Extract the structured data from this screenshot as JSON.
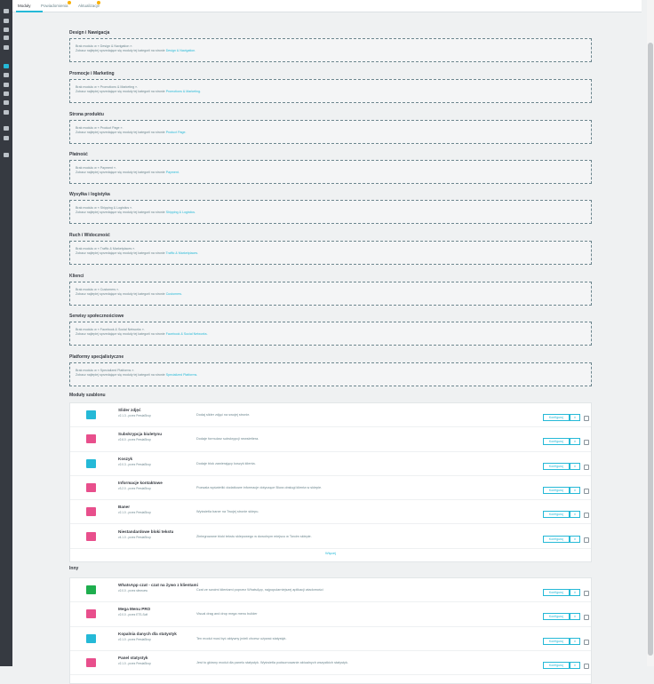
{
  "tabs": [
    {
      "label": "Moduły"
    },
    {
      "label": "Powiadomienia"
    },
    {
      "label": "Aktualizacje"
    }
  ],
  "categories": [
    {
      "title": "Design i Nawigacja",
      "line1": "Brak modułu w « Design & Navigation ».",
      "line2": "Zobacz najlepiej sprzedające się moduły tej kategorii na stronie",
      "link": "Design & Navigation."
    },
    {
      "title": "Promocje i Marketing",
      "line1": "Brak modułu w « Promotions & Marketing ».",
      "line2": "Zobacz najlepiej sprzedające się moduły tej kategorii na stronie",
      "link": "Promotions & Marketing."
    },
    {
      "title": "Strona produktu",
      "line1": "Brak modułu w « Product Page ».",
      "line2": "Zobacz najlepiej sprzedające się moduły tej kategorii na stronie",
      "link": "Product Page."
    },
    {
      "title": "Płatność",
      "line1": "Brak modułu w « Payment ».",
      "line2": "Zobacz najlepiej sprzedające się moduły tej kategorii na stronie",
      "link": "Payment."
    },
    {
      "title": "Wysyłka i logistyka",
      "line1": "Brak modułu w « Shipping & Logistics ».",
      "line2": "Zobacz najlepiej sprzedające się moduły tej kategorii na stronie",
      "link": "Shipping & Logistics."
    },
    {
      "title": "Ruch i Widoczność",
      "line1": "Brak modułu w « Traffic & Marketplaces ».",
      "line2": "Zobacz najlepiej sprzedające się moduły tej kategorii na stronie",
      "link": "Traffic & Marketplaces."
    },
    {
      "title": "Klienci",
      "line1": "Brak modułu w « Customers ».",
      "line2": "Zobacz najlepiej sprzedające się moduły tej kategorii na stronie",
      "link": "Customers."
    },
    {
      "title": "Serwisy społecznościowe",
      "line1": "Brak modułu w « Facebook & Social Networks ».",
      "line2": "Zobacz najlepiej sprzedające się moduły tej kategorii na stronie",
      "link": "Facebook & Social Networks."
    },
    {
      "title": "Platformy specjalistyczne",
      "line1": "Brak modułu w « Specialized Platforms ».",
      "line2": "Zobacz najlepiej sprzedające się moduły tej kategorii na stronie",
      "link": "Specialized Platforms."
    }
  ],
  "theme_modules": {
    "title": "Moduły szablonu",
    "more": "Więcej",
    "items": [
      {
        "name": "Slider zdjęć",
        "version": "v2.1.3 - przez PrestaShop",
        "desc": "Dodaj slider zdjęć na swojej stronie.",
        "icon_color": "#25b9d7",
        "icon": "image-slider-icon"
      },
      {
        "name": "Subskrypcja biuletynu",
        "version": "v2.6.0 - przez PrestaShop",
        "desc": "Dodaje formularz subskrypcji newslettera.",
        "icon_color": "#e84f8c",
        "icon": "newsletter-icon"
      },
      {
        "name": "Koszyk",
        "version": "v2.0.3 - przez PrestaShop",
        "desc": "Dodaje blok zawierający koszyk klienta.",
        "icon_color": "#25b9d7",
        "icon": "cart-icon"
      },
      {
        "name": "Informacje kontaktowe",
        "version": "v3.2.0 - przez PrestaShop",
        "desc": "Pozwala wyświetlić dodatkowe informacje dotyczące Biura obsługi klienta w sklepie.",
        "icon_color": "#e84f8c",
        "icon": "contact-icon"
      },
      {
        "name": "Baner",
        "version": "v2.1.0 - przez PrestaShop",
        "desc": "Wyświetla baner na Twojej stronie sklepu.",
        "icon_color": "#e84f8c",
        "icon": "banner-icon"
      },
      {
        "name": "Niestandardowe bloki tekstu",
        "version": "v4.1.0 - przez PrestaShop",
        "desc": "Zintegrowane bloki tekstu sklepowego w dowolnym miejscu w Twoim sklepie.",
        "icon_color": "#e84f8c",
        "icon": "text-block-icon"
      }
    ]
  },
  "other_modules": {
    "title": "Inny",
    "items": [
      {
        "name": "WhatsApp czat - czat na żywo z klientami",
        "version": "v2.0.0 - przez sfmeuew",
        "desc": "Czat ze swoimi klientami poprzez WhatsApp, najpopularniejszej aplikacji wiadomości",
        "icon_color": "#1eae4e",
        "icon": "whatsapp-icon"
      },
      {
        "name": "Mega Menu PRO",
        "version": "v2.0.0 - przez ETS-Soft",
        "desc": "Visual drag and drop mega menu builder",
        "icon_color": "#e84f8c",
        "icon": "mega-menu-icon"
      },
      {
        "name": "Kopalnia danych dla statystyk",
        "version": "v2.1.0 - przez PrestaShop",
        "desc": "Ten moduł musi być aktywny jeżeli chcesz używać statystyk.",
        "icon_color": "#25b9d7",
        "icon": "data-mining-icon"
      },
      {
        "name": "Panel statystyk",
        "version": "v2.1.0 - przez PrestaShop",
        "desc": "Jest to główny moduł dla panelu statystyk. Wyświetla podsumowanie aktualnych wszystkich statystyk.",
        "icon_color": "#e84f8c",
        "icon": "stats-panel-icon"
      }
    ]
  },
  "buttons": {
    "configure": "Konfiguruj",
    "dropdown": "∨"
  }
}
